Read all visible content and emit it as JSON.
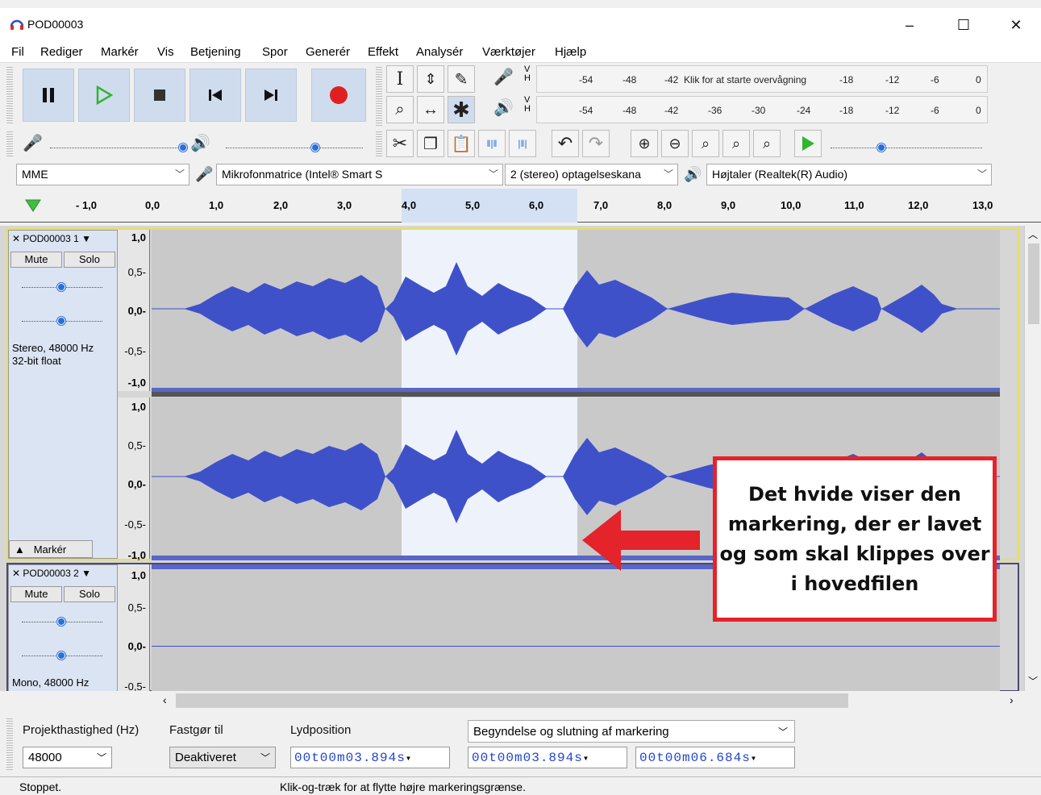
{
  "window": {
    "title": "POD00003",
    "minimize": "–",
    "maximize": "☐",
    "close": "✕"
  },
  "menu": [
    "Fil",
    "Rediger",
    "Markér",
    "Vis",
    "Betjening",
    "Spor",
    "Generér",
    "Effekt",
    "Analysér",
    "Værktøjer",
    "Hjælp"
  ],
  "meters": {
    "record_ticks": [
      "-54",
      "-48",
      "-42",
      "-18",
      "-12",
      "-6",
      "0"
    ],
    "monitor_hint": "Klik for at starte overvågning",
    "play_ticks": [
      "-54",
      "-48",
      "-42",
      "-36",
      "-30",
      "-24",
      "-18",
      "-12",
      "-6",
      "0"
    ],
    "vh": "V\nH"
  },
  "device": {
    "host": "MME",
    "input": "Mikrofonmatrice (Intel® Smart S",
    "channels": "2 (stereo) optagelseskana",
    "output": "Højtaler (Realtek(R) Audio)"
  },
  "ruler": {
    "labels": [
      "- 1,0",
      "0,0",
      "1,0",
      "2,0",
      "3,0",
      "4,0",
      "5,0",
      "6,0",
      "7,0",
      "8,0",
      "9,0",
      "10,0",
      "11,0",
      "12,0",
      "13,0"
    ]
  },
  "track1": {
    "name": "POD00003 1",
    "mute": "Mute",
    "solo": "Solo",
    "format": "Stereo, 48000 Hz",
    "bits": "32-bit float",
    "select": "Markér",
    "scale": [
      "1,0",
      "0,5-",
      "0,0-",
      "-0,5-",
      "-1,0"
    ]
  },
  "track2": {
    "name": "POD00003 2",
    "mute": "Mute",
    "solo": "Solo",
    "format": "Mono, 48000 Hz",
    "scale": [
      "1,0",
      "0,5-",
      "0,0-",
      "-0,5-"
    ]
  },
  "bottom": {
    "rate_label": "Projekthastighed (Hz)",
    "rate_value": "48000",
    "snap_label": "Fastgør til",
    "snap_value": "Deaktiveret",
    "pos_label": "Lydposition",
    "pos_value": "00t00m03.894s",
    "sel_label": "Begyndelse og slutning af markering",
    "sel_start": "00t00m03.894s",
    "sel_end": "00t00m06.684s"
  },
  "status": {
    "left": "Stoppet.",
    "right": "Klik-og-træk for at flytte højre markeringsgrænse."
  },
  "annotation": "Det hvide viser den markering, der er lavet og som skal klippes over i hovedfilen",
  "colors": {
    "waveform": "#3f51c9",
    "selection": "#eef3fb",
    "annotation_border": "#e4232a",
    "record": "#e02020",
    "play": "#2fb52f"
  }
}
